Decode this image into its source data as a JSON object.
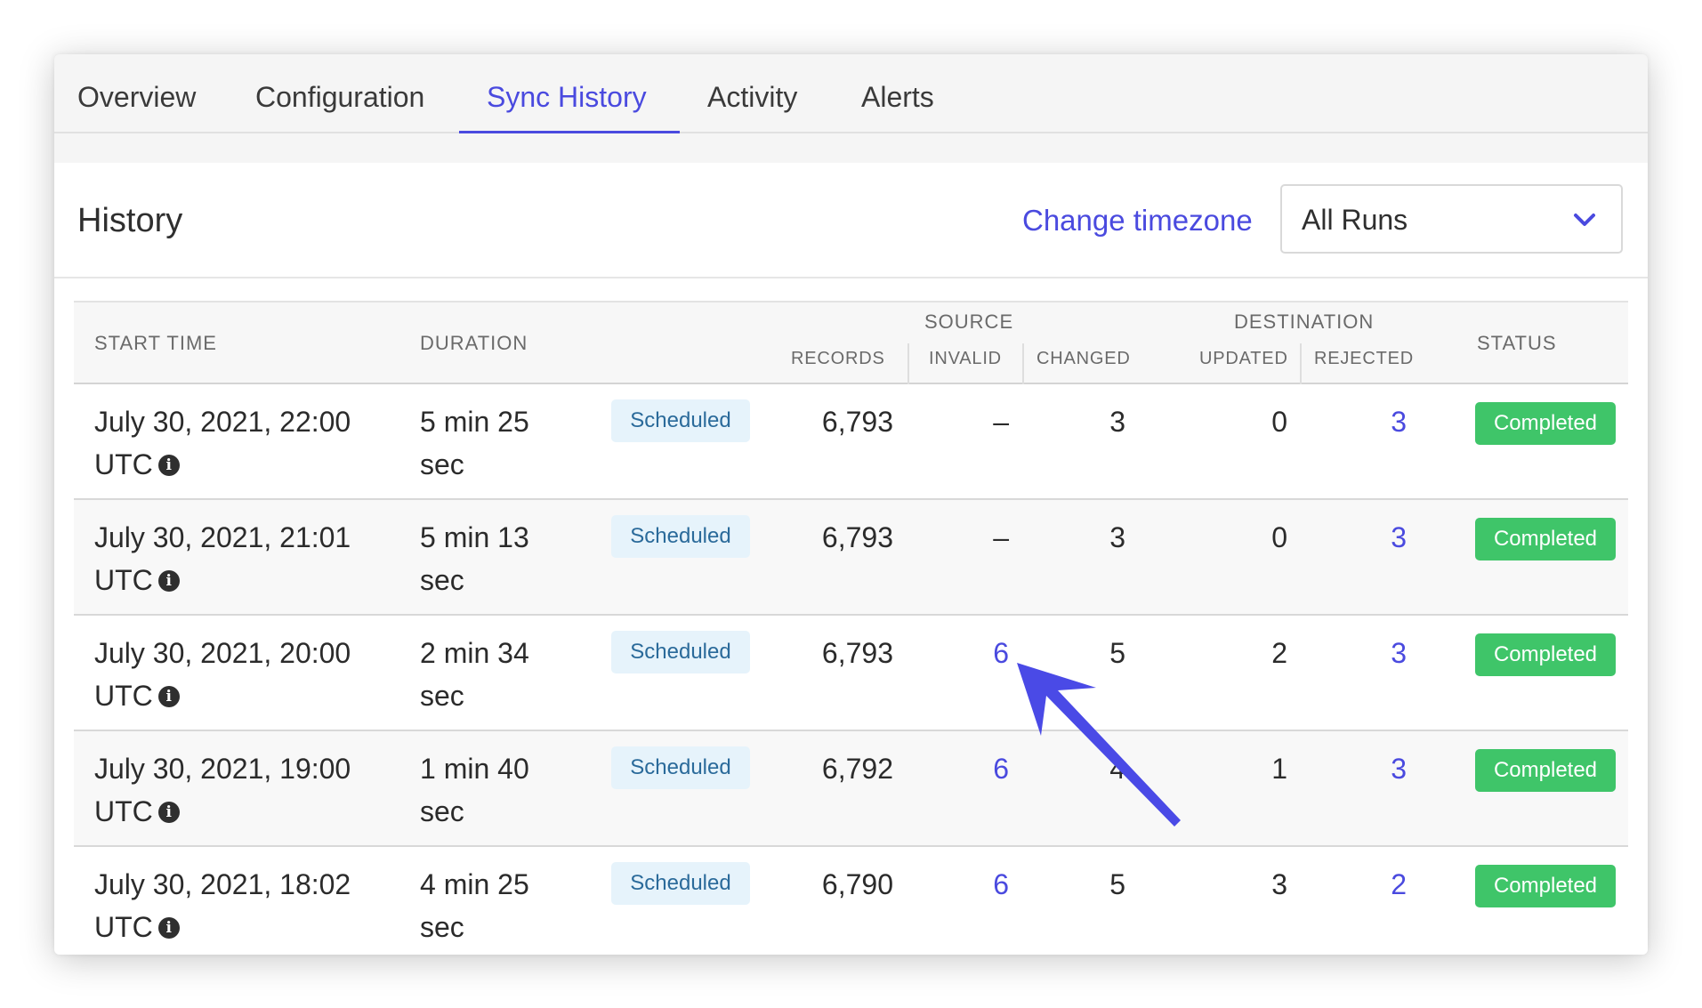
{
  "tabs": [
    {
      "label": "Overview",
      "active": false
    },
    {
      "label": "Configuration",
      "active": false
    },
    {
      "label": "Sync History",
      "active": true
    },
    {
      "label": "Activity",
      "active": false
    },
    {
      "label": "Alerts",
      "active": false
    }
  ],
  "header": {
    "title": "History",
    "timezone_link": "Change timezone",
    "filter": {
      "selected": "All Runs"
    }
  },
  "columns": {
    "start_time": "START TIME",
    "duration": "DURATION",
    "source_group": "SOURCE",
    "destination_group": "DESTINATION",
    "records": "RECORDS",
    "invalid": "INVALID",
    "changed": "CHANGED",
    "updated": "UPDATED",
    "rejected": "REJECTED",
    "status": "STATUS"
  },
  "rows": [
    {
      "start_date": "July 30, 2021, 22:00",
      "start_tz": "UTC",
      "duration_a": "5 min 25",
      "duration_b": "sec",
      "trigger": "Scheduled",
      "records": "6,793",
      "invalid": "–",
      "changed": "3",
      "updated": "0",
      "rejected": "3",
      "status": "Completed"
    },
    {
      "start_date": "July 30, 2021, 21:01",
      "start_tz": "UTC",
      "duration_a": "5 min 13",
      "duration_b": "sec",
      "trigger": "Scheduled",
      "records": "6,793",
      "invalid": "–",
      "changed": "3",
      "updated": "0",
      "rejected": "3",
      "status": "Completed"
    },
    {
      "start_date": "July 30, 2021, 20:00",
      "start_tz": "UTC",
      "duration_a": "2 min 34",
      "duration_b": "sec",
      "trigger": "Scheduled",
      "records": "6,793",
      "invalid": "6",
      "changed": "5",
      "updated": "2",
      "rejected": "3",
      "status": "Completed"
    },
    {
      "start_date": "July 30, 2021, 19:00",
      "start_tz": "UTC",
      "duration_a": "1 min 40",
      "duration_b": "sec",
      "trigger": "Scheduled",
      "records": "6,792",
      "invalid": "6",
      "changed": "4",
      "updated": "1",
      "rejected": "3",
      "status": "Completed"
    },
    {
      "start_date": "July 30, 2021, 18:02",
      "start_tz": "UTC",
      "duration_a": "4 min 25",
      "duration_b": "sec",
      "trigger": "Scheduled",
      "records": "6,790",
      "invalid": "6",
      "changed": "5",
      "updated": "3",
      "rejected": "2",
      "status": "Completed"
    }
  ],
  "colors": {
    "accent": "#4a4adf",
    "completed": "#3fc569",
    "scheduled_bg": "#e6f3fb",
    "scheduled_text": "#2a6a9a",
    "annotation_arrow": "#4a4ae6"
  },
  "icons": {
    "info": "info-circle-icon",
    "dropdown": "chevron-down-icon",
    "annotation": "pointer-arrow-annotation"
  }
}
